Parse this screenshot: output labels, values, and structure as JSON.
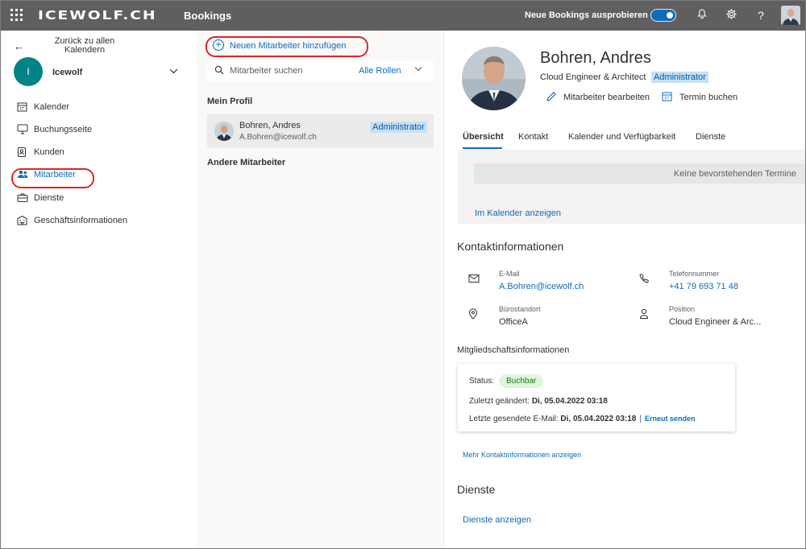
{
  "topbar": {
    "brand": "ICEWOLF.CH",
    "app_name": "Bookings",
    "try_new_label": "Neue Bookings ausprobieren",
    "help_glyph": "?"
  },
  "leftnav": {
    "back_label": "Zurück zu allen Kalendern",
    "business": {
      "initial": "I",
      "name": "Icewolf",
      "color": "#038387"
    },
    "items": [
      {
        "label": "Kalender",
        "icon": "calendar-icon"
      },
      {
        "label": "Buchungsseite",
        "icon": "monitor-icon"
      },
      {
        "label": "Kunden",
        "icon": "contact-card-icon"
      },
      {
        "label": "Mitarbeiter",
        "icon": "people-icon",
        "active": true
      },
      {
        "label": "Dienste",
        "icon": "briefcase-icon"
      },
      {
        "label": "Geschäftsinformationen",
        "icon": "building-icon"
      }
    ]
  },
  "middle": {
    "add_button": "Neuen Mitarbeiter hinzufügen",
    "search_placeholder": "Mitarbeiter suchen",
    "roles_filter": "Alle Rollen",
    "my_profile_heading": "Mein Profil",
    "other_staff_heading": "Andere Mitarbeiter",
    "profile": {
      "name": "Bohren, Andres",
      "email": "A.Bohren@icewolf.ch",
      "role": "Administrator"
    }
  },
  "detail": {
    "name": "Bohren, Andres",
    "job_title": "Cloud Engineer & Architect",
    "role": "Administrator",
    "actions": {
      "edit": "Mitarbeiter bearbeiten",
      "book": "Termin buchen"
    },
    "tabs": [
      "Übersicht",
      "Kontakt",
      "Kalender und Verfügbarkeit",
      "Dienste"
    ],
    "active_tab": "Übersicht",
    "no_appointments": "Keine bevorstehenden Termine",
    "view_in_calendar": "Im Kalender anzeigen",
    "contact_heading": "Kontaktinformationen",
    "contact": {
      "email_label": "E-Mail",
      "email_value": "A.Bohren@icewolf.ch",
      "phone_label": "Telefonnummer",
      "phone_value": "+41 79 693 71 48",
      "office_label": "Bürostandort",
      "office_value": "OfficeA",
      "position_label": "Position",
      "position_value": "Cloud Engineer & Arc..."
    },
    "membership_heading": "Mitgliedschaftsinformationen",
    "membership": {
      "status_label": "Status:",
      "status_value": "Buchbar",
      "last_changed_label": "Zuletzt geändert:",
      "last_changed_value": "Di, 05.04.2022 03:18",
      "last_email_label": "Letzte gesendete E-Mail:",
      "last_email_value": "Di, 05.04.2022 03:18",
      "separator": "|",
      "resend": "Erneut senden"
    },
    "more_contact_link": "Mehr Kontaktinformationen anzeigen",
    "services_heading": "Dienste",
    "services_link": "Dienste anzeigen"
  },
  "colors": {
    "accent": "#0f6cbd",
    "topbar": "#5f5f5f",
    "highlight_oval": "#d9262a",
    "badge_bg": "#c7e0f4",
    "status_bg": "#dff6dd"
  }
}
